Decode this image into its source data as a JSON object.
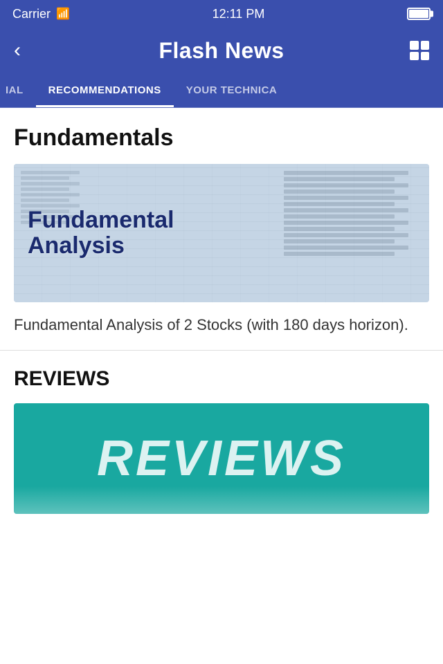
{
  "statusBar": {
    "carrier": "Carrier",
    "time": "12:11 PM"
  },
  "navBar": {
    "backLabel": "<",
    "title": "Flash News"
  },
  "tabs": [
    {
      "id": "ial",
      "label": "IAL",
      "active": false,
      "partial": "left"
    },
    {
      "id": "recommendations",
      "label": "RECOMMENDATIONS",
      "active": true
    },
    {
      "id": "your-technica",
      "label": "YOUR TECHNICA",
      "active": false,
      "partial": "right"
    }
  ],
  "sections": [
    {
      "id": "fundamentals",
      "title": "Fundamentals",
      "imageLabel1": "Fundamental",
      "imageLabel2": "Analysis",
      "description": "Fundamental Analysis of 2 Stocks (with 180 days horizon)."
    },
    {
      "id": "reviews",
      "title": "REVIEWS",
      "reviewsText": "REVIEWS"
    }
  ]
}
